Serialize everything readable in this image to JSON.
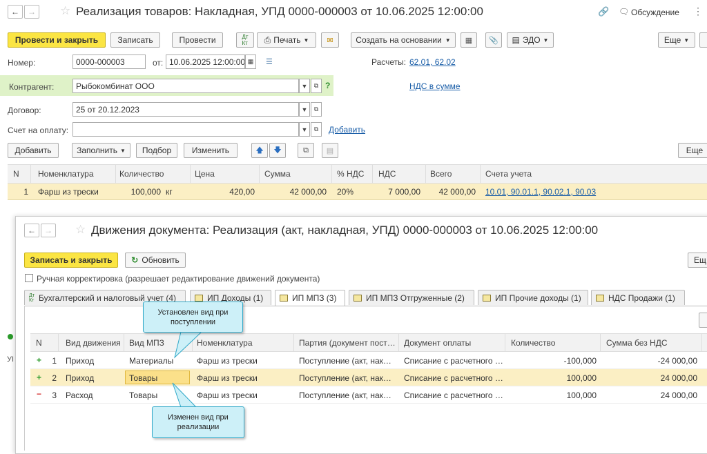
{
  "main": {
    "title": "Реализация товаров: Накладная, УПД 0000-000003 от 10.06.2025 12:00:00",
    "discussion": "Обсуждение",
    "toolbar": {
      "post_close": "Провести и закрыть",
      "save": "Записать",
      "post": "Провести",
      "print": "Печать",
      "create_based": "Создать на основании",
      "edo": "ЭДО",
      "more": "Еще"
    },
    "number_label": "Номер:",
    "number_value": "0000-000003",
    "date_label": "от:",
    "date_value": "10.06.2025 12:00:00",
    "calc_label": "Расчеты:",
    "calc_link": "62.01, 62.02",
    "contractor_label": "Контрагент:",
    "contractor_value": "Рыбокомбинат ООО",
    "vat_link": "НДС в сумме",
    "contract_label": "Договор:",
    "contract_value": "25 от 20.12.2023",
    "invoice_label": "Счет на оплату:",
    "invoice_value": "",
    "add_link": "Добавить",
    "table_toolbar": {
      "add": "Добавить",
      "fill": "Заполнить",
      "pick": "Подбор",
      "change": "Изменить",
      "more": "Еще"
    },
    "columns": [
      "N",
      "Номенклатура",
      "Количество",
      "Цена",
      "Сумма",
      "% НДС",
      "НДС",
      "Всего",
      "Счета учета"
    ],
    "row": {
      "n": "1",
      "item": "Фарш из трески",
      "qty": "100,000",
      "unit": "кг",
      "price": "420,00",
      "sum": "42 000,00",
      "vat_rate": "20%",
      "vat": "7 000,00",
      "total": "42 000,00",
      "accounts": "10.01, 90.01.1, 90.02.1, 90.03"
    },
    "left_cut": "УІ"
  },
  "moves": {
    "title": "Движения документа: Реализация (акт, накладная, УПД) 0000-000003 от 10.06.2025 12:00:00",
    "save_close": "Записать и закрыть",
    "refresh": "Обновить",
    "more": "Ещ",
    "manual_label": "Ручная корректировка (разрешает редактирование движений документа)",
    "tabs": [
      "Бухгалтерский и налоговый учет (4)",
      "ИП Доходы (1)",
      "ИП МПЗ (3)",
      "ИП МПЗ Отгруженные (2)",
      "ИП Прочие доходы (1)",
      "НДС Продажи (1)"
    ],
    "columns": [
      "N",
      "Вид движения",
      "Вид МПЗ",
      "Номенклатура",
      "Партия (документ пост…",
      "Документ оплаты",
      "Количество",
      "Сумма без НДС"
    ],
    "rows": [
      {
        "sign": "+",
        "n": "1",
        "move": "Приход",
        "kind": "Материалы",
        "item": "Фарш из трески",
        "batch": "Поступление (акт, нак…",
        "pay": "Списание с расчетного …",
        "qty": "-100,000",
        "sum": "-24 000,00"
      },
      {
        "sign": "+",
        "n": "2",
        "move": "Приход",
        "kind": "Товары",
        "item": "Фарш из трески",
        "batch": "Поступление (акт, нак…",
        "pay": "Списание с расчетного …",
        "qty": "100,000",
        "sum": "24 000,00"
      },
      {
        "sign": "−",
        "n": "3",
        "move": "Расход",
        "kind": "Товары",
        "item": "Фарш из трески",
        "batch": "Поступление (акт, нак…",
        "pay": "Списание с расчетного …",
        "qty": "100,000",
        "sum": "24 000,00"
      }
    ],
    "callout_top": "Установлен вид при поступлении",
    "callout_bottom": "Изменен вид при реализации"
  },
  "colors": {
    "primary_button": "#fbe543",
    "selected_row": "#fbefc4",
    "link": "#1a5ea8",
    "callout_bg": "#cdf0f8",
    "callout_border": "#2fa8c8",
    "contractor_highlight": "#dff2c8"
  }
}
